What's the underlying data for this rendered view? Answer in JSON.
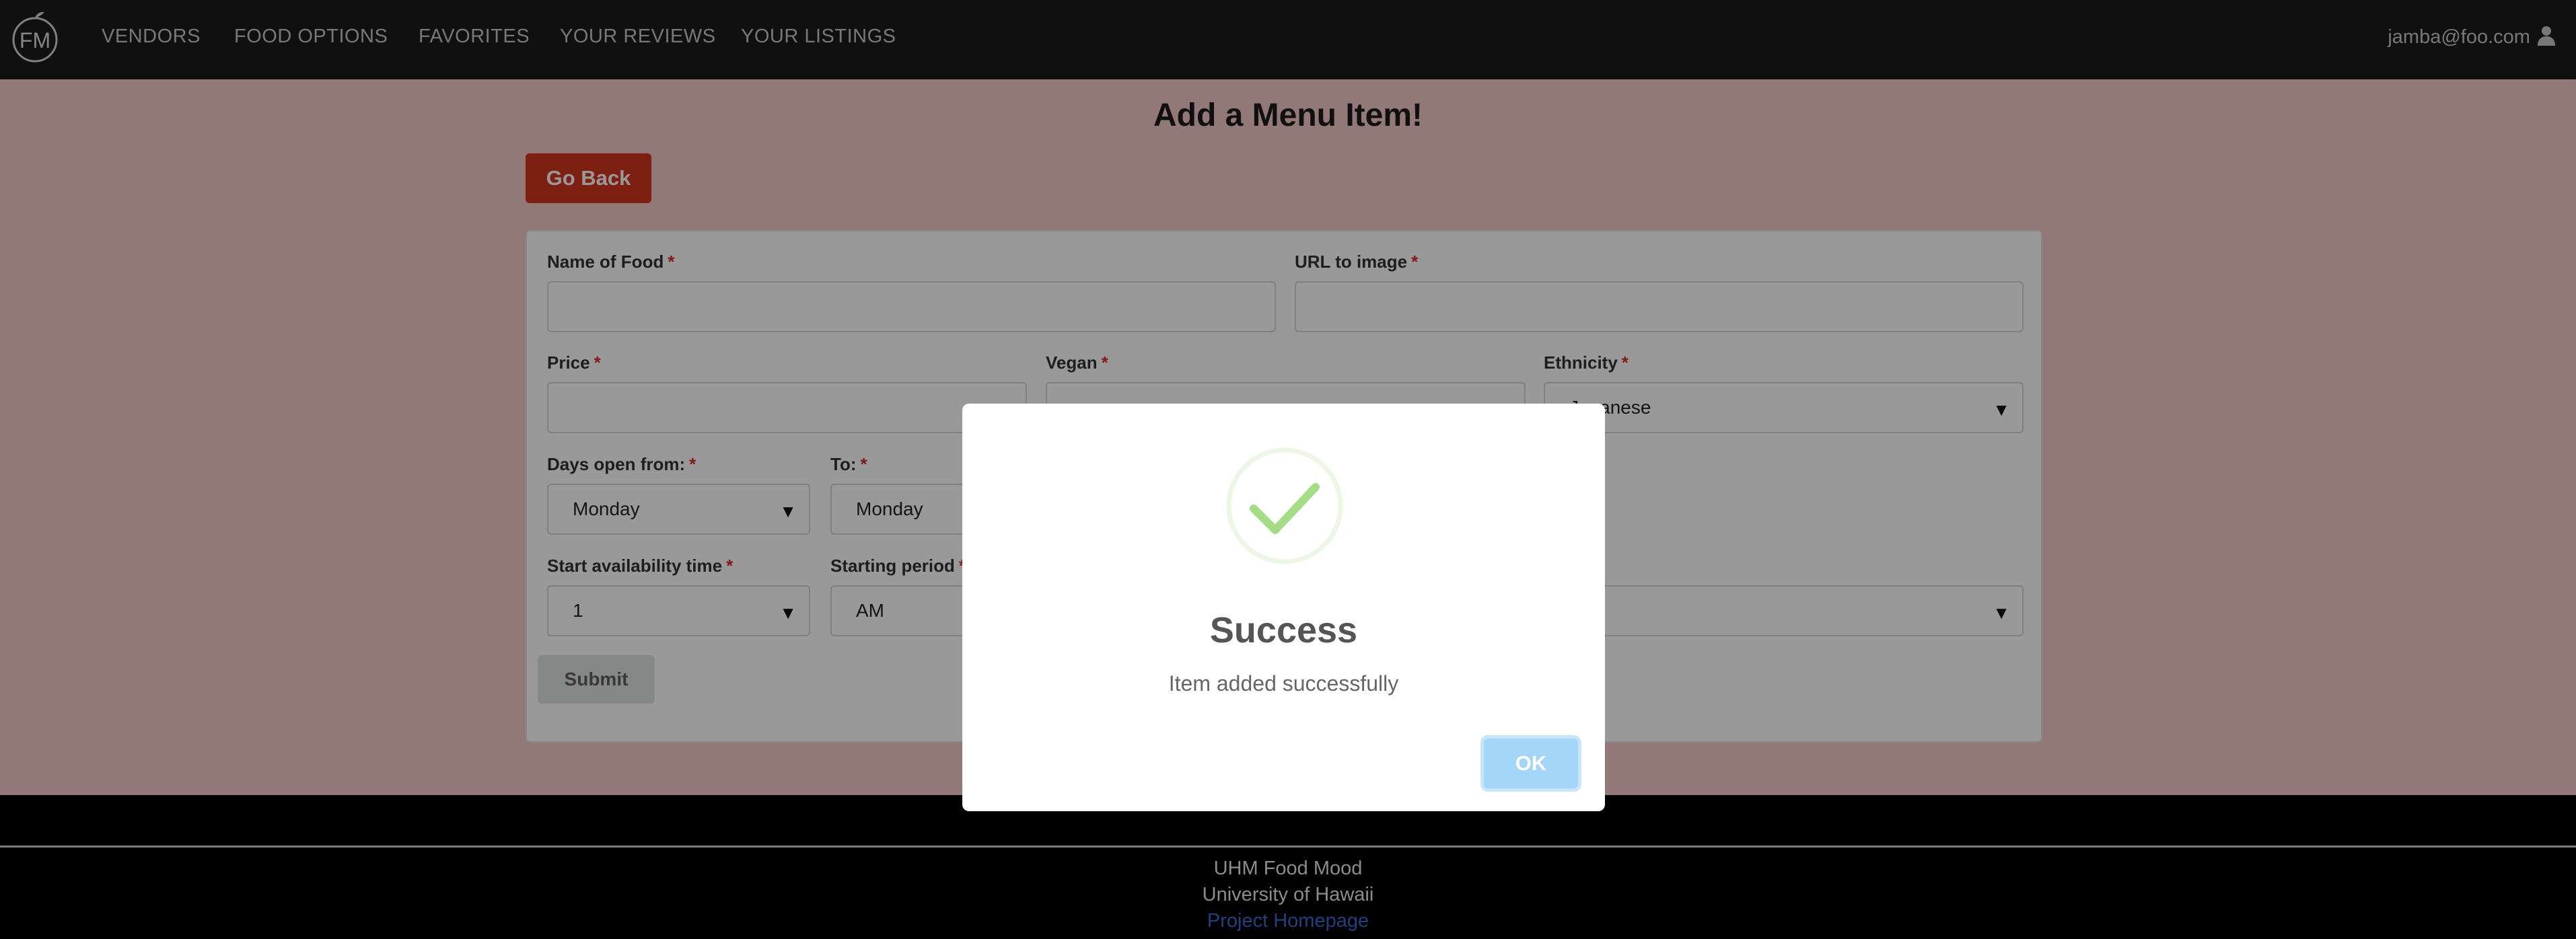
{
  "navbar": {
    "logo_text": "FM",
    "items": [
      {
        "label": "VENDORS"
      },
      {
        "label": "FOOD OPTIONS"
      },
      {
        "label": "FAVORITES"
      },
      {
        "label": "YOUR REVIEWS"
      },
      {
        "label": "YOUR LISTINGS"
      }
    ],
    "user_email": "jamba@foo.com"
  },
  "page": {
    "title": "Add a Menu Item!",
    "go_back_label": "Go Back"
  },
  "form": {
    "name_label": "Name of Food",
    "url_label": "URL to image",
    "price_label": "Price",
    "vegan_label": "Vegan",
    "ethnicity_label": "Ethnicity",
    "ethnicity_value": "Japanese",
    "days_from_label": "Days open from:",
    "days_from_value": "Monday",
    "to_label": "To:",
    "to_value": "Monday",
    "start_time_label": "Start availability time",
    "start_time_value": "1",
    "start_period_label": "Starting period",
    "start_period_value": "AM",
    "required_mark": "*",
    "submit_label": "Submit"
  },
  "footer": {
    "line1": "UHM Food Mood",
    "line2": "University of Hawaii",
    "link": "Project Homepage"
  },
  "modal": {
    "title": "Success",
    "message": "Item added successfully",
    "ok_label": "OK",
    "icon": "checkmark-icon"
  },
  "colors": {
    "navbar": "#1b1c1d",
    "page_background": "#f3c9c6",
    "go_back": "#d0361e",
    "ok_button": "#a3d6f7",
    "check_green": "#a5dc86"
  }
}
